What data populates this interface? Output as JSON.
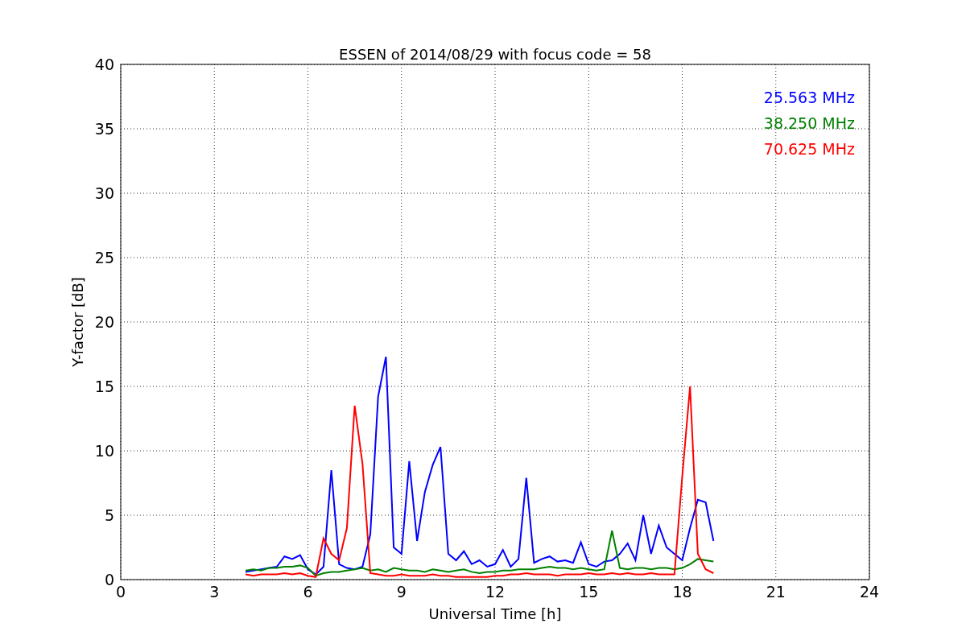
{
  "figure": {
    "chart_data": {
      "type": "line",
      "title": "ESSEN of 2014/08/29 with focus code = 58",
      "xlabel": "Universal Time [h]",
      "ylabel": "Y-factor [dB]",
      "grid": true,
      "xlim": [
        0,
        24
      ],
      "ylim": [
        0,
        40
      ],
      "xticks": [
        0,
        3,
        6,
        9,
        12,
        15,
        18,
        21,
        24
      ],
      "yticks": [
        0,
        5,
        10,
        15,
        20,
        25,
        30,
        35,
        40
      ],
      "x": [
        4,
        4.25,
        4.5,
        4.75,
        5,
        5.25,
        5.5,
        5.75,
        6,
        6.25,
        6.5,
        6.75,
        7,
        7.25,
        7.5,
        7.75,
        8,
        8.25,
        8.5,
        8.75,
        9,
        9.25,
        9.5,
        9.75,
        10,
        10.25,
        10.5,
        10.75,
        11,
        11.25,
        11.5,
        11.75,
        12,
        12.25,
        12.5,
        12.75,
        13,
        13.25,
        13.5,
        13.75,
        14,
        14.25,
        14.5,
        14.75,
        15,
        15.25,
        15.5,
        15.75,
        16,
        16.25,
        16.5,
        16.75,
        17,
        17.25,
        17.5,
        17.75,
        18,
        18.25,
        18.5,
        18.75,
        19
      ],
      "series": [
        {
          "name": "25.563 MHz",
          "color": "#0000ff",
          "values": [
            0.6,
            0.7,
            0.8,
            0.9,
            1.0,
            1.8,
            1.6,
            1.9,
            0.8,
            0.4,
            1.0,
            8.5,
            1.2,
            0.9,
            0.8,
            1.0,
            3.5,
            14.2,
            17.3,
            2.5,
            2.0,
            9.2,
            3.0,
            6.8,
            8.9,
            10.3,
            2.0,
            1.5,
            2.2,
            1.2,
            1.5,
            1.0,
            1.2,
            2.3,
            1.0,
            1.6,
            7.9,
            1.3,
            1.6,
            1.8,
            1.4,
            1.5,
            1.3,
            2.9,
            1.2,
            1.0,
            1.4,
            1.5,
            2.0,
            2.8,
            1.5,
            5.0,
            2.0,
            4.2,
            2.5,
            2.0,
            1.5,
            4.0,
            6.2,
            6.0,
            3.0
          ]
        },
        {
          "name": "38.250 MHz",
          "color": "#008000",
          "values": [
            0.7,
            0.8,
            0.7,
            0.9,
            0.9,
            1.0,
            1.0,
            1.1,
            0.9,
            0.3,
            0.5,
            0.6,
            0.6,
            0.7,
            0.8,
            0.9,
            0.7,
            0.8,
            0.6,
            0.9,
            0.8,
            0.7,
            0.7,
            0.6,
            0.8,
            0.7,
            0.6,
            0.7,
            0.8,
            0.6,
            0.5,
            0.6,
            0.6,
            0.7,
            0.7,
            0.8,
            0.8,
            0.8,
            0.9,
            1.0,
            0.9,
            0.9,
            0.8,
            0.9,
            0.8,
            0.7,
            0.8,
            3.8,
            0.9,
            0.8,
            0.9,
            0.9,
            0.8,
            0.9,
            0.9,
            0.8,
            0.9,
            1.2,
            1.6,
            1.5,
            1.4
          ]
        },
        {
          "name": "70.625 MHz",
          "color": "#ff0000",
          "values": [
            0.4,
            0.3,
            0.4,
            0.4,
            0.4,
            0.5,
            0.4,
            0.5,
            0.3,
            0.2,
            3.2,
            2.0,
            1.5,
            4.0,
            13.5,
            9.0,
            0.5,
            0.4,
            0.3,
            0.3,
            0.4,
            0.3,
            0.3,
            0.3,
            0.4,
            0.3,
            0.3,
            0.2,
            0.2,
            0.2,
            0.2,
            0.2,
            0.3,
            0.3,
            0.4,
            0.4,
            0.5,
            0.4,
            0.4,
            0.4,
            0.3,
            0.4,
            0.4,
            0.4,
            0.5,
            0.4,
            0.4,
            0.5,
            0.4,
            0.5,
            0.4,
            0.4,
            0.5,
            0.4,
            0.4,
            0.4,
            8.0,
            15.0,
            2.0,
            0.8,
            0.5
          ]
        }
      ]
    }
  }
}
